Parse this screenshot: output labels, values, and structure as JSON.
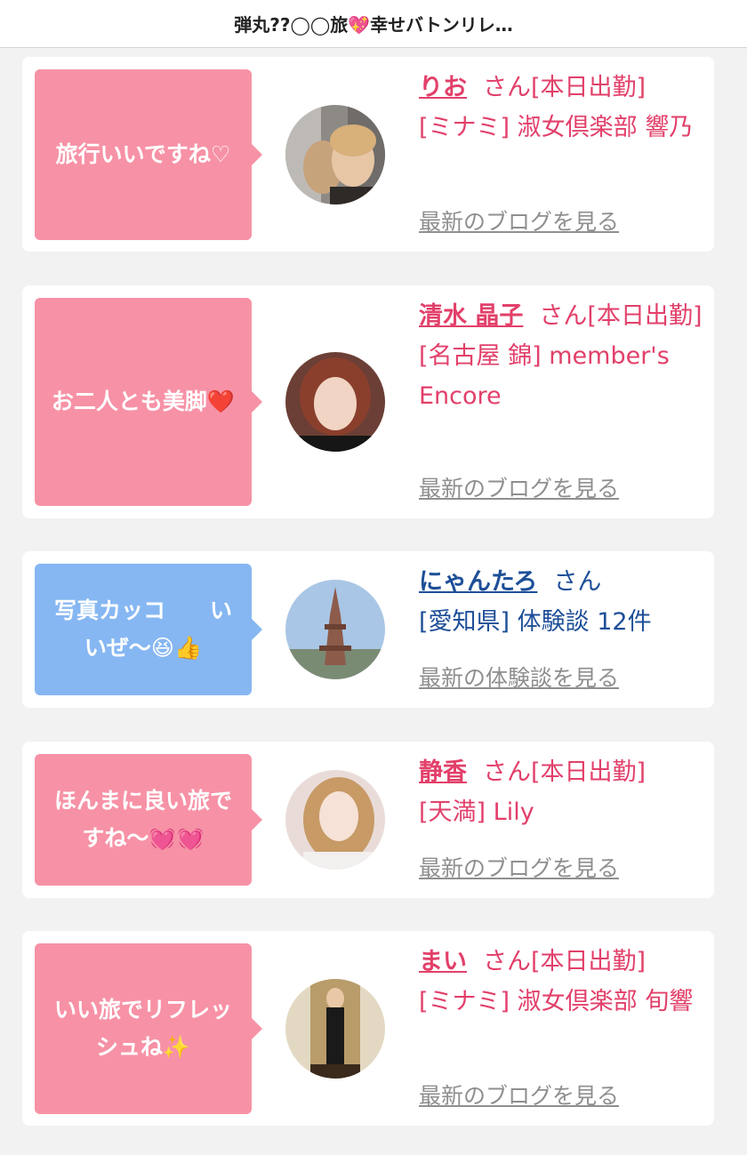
{
  "header": {
    "title": "弾丸??◯◯旅💖幸せバトンリレ…"
  },
  "cards": [
    {
      "comment": "旅行いいですね♡",
      "name": "りお",
      "suffix": "さん[本日出勤]",
      "shop": "[ミナミ] 淑女倶楽部 響乃",
      "link": "最新のブログを見る",
      "style": "pink"
    },
    {
      "comment": "お二人とも美脚❤️",
      "name": "清水 晶子",
      "suffix": "さん[本日出勤]",
      "shop": "[名古屋 錦] member's Encore",
      "link": "最新のブログを見る",
      "style": "pink"
    },
    {
      "comment": "写真カッコ　　いいぜ〜😆👍",
      "name": "にゃんたろ",
      "suffix": "さん",
      "shop": "[愛知県] 体験談 12件",
      "link": "最新の体験談を見る",
      "style": "blue"
    },
    {
      "comment": "ほんまに良い旅ですね〜💓💓",
      "name": "静香",
      "suffix": "さん[本日出勤]",
      "shop": "[天満] Lily",
      "link": "最新のブログを見る",
      "style": "pink"
    },
    {
      "comment": "いい旅でリフレッシュね✨",
      "name": "まい",
      "suffix": "さん[本日出勤]",
      "shop": "[ミナミ] 淑女倶楽部 旬響",
      "link": "最新のブログを見る",
      "style": "pink"
    }
  ],
  "colors": {
    "pink_bubble": "#f792a6",
    "blue_bubble": "#86b7f2",
    "pink_text": "#e2406a",
    "blue_text": "#1e4f98",
    "link_gray": "#8f8f8f"
  },
  "avatar_icons": [
    "selfie-photo",
    "portrait-photo",
    "tower-photo",
    "portrait-photo",
    "full-body-photo"
  ]
}
